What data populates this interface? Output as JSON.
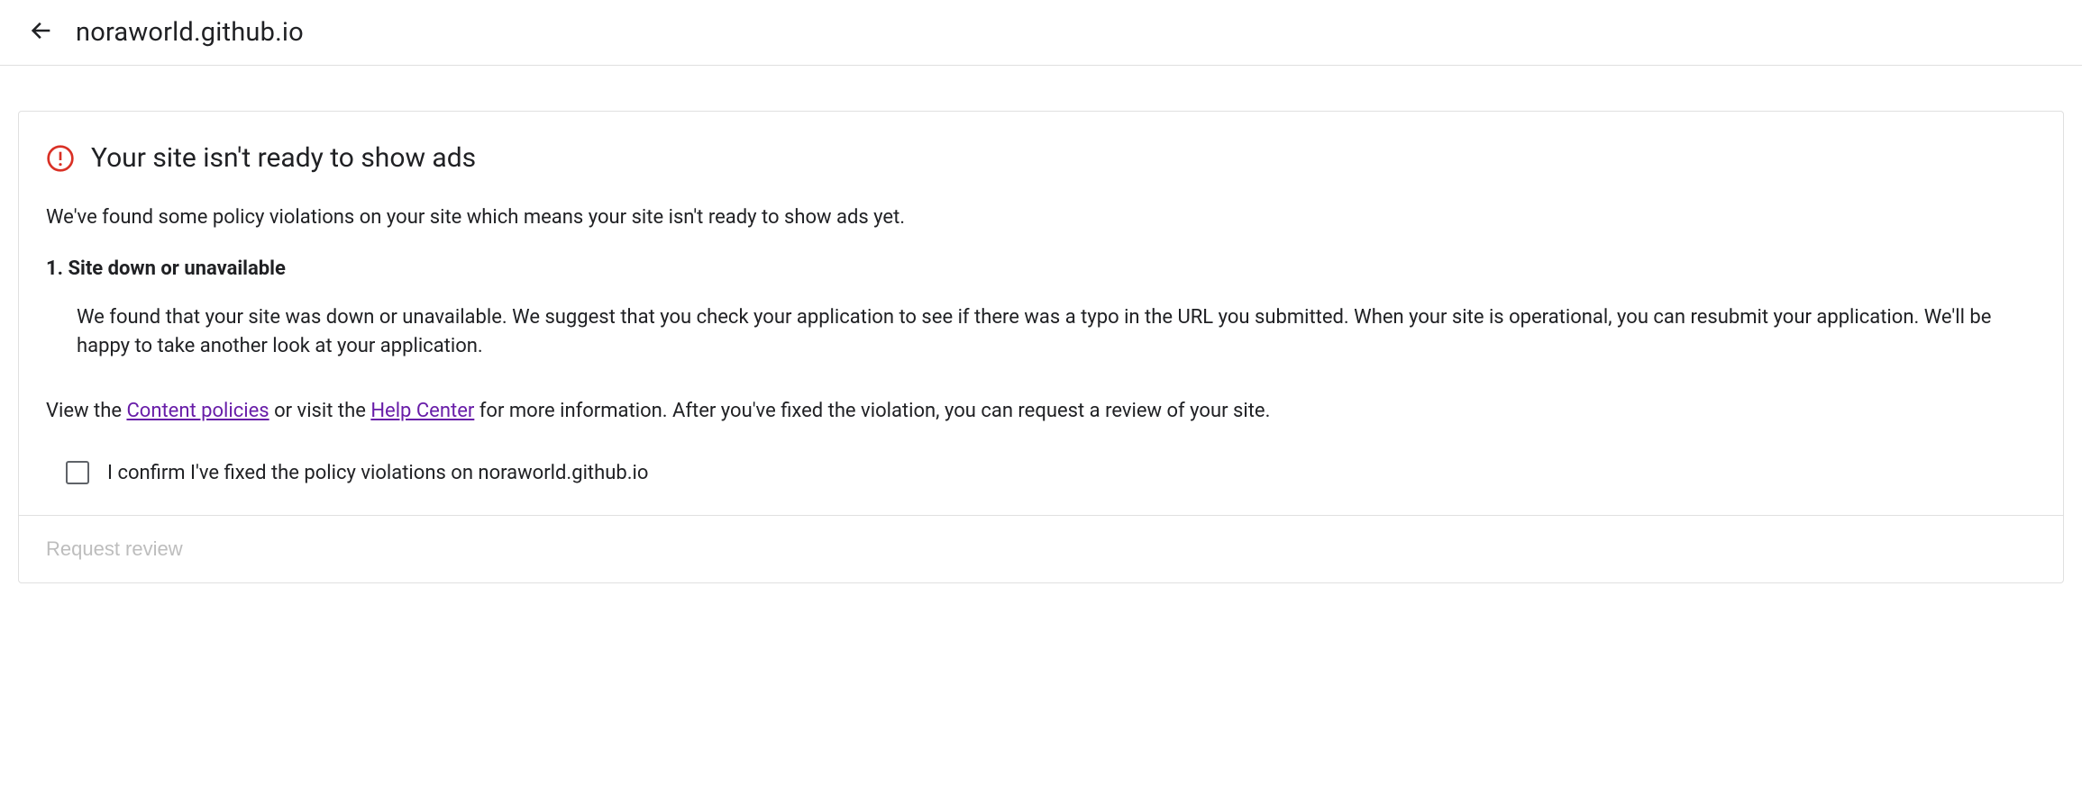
{
  "header": {
    "domain": "noraworld.github.io"
  },
  "card": {
    "title": "Your site isn't ready to show ads",
    "intro": "We've found some policy violations on your site which means your site isn't ready to show ads yet.",
    "violation_heading": "1. Site down or unavailable",
    "violation_body": "We found that your site was down or unavailable. We suggest that you check your application to see if there was a typo in the URL you submitted. When your site is operational, you can resubmit your application. We'll be happy to take another look at your application.",
    "info_pre": "View the ",
    "link1": "Content policies",
    "info_mid": " or visit the ",
    "link2": "Help Center",
    "info_post": " for more information. After you've fixed the violation, you can request a review of your site.",
    "confirm_label": "I confirm I've fixed the policy violations on noraworld.github.io",
    "request_button": "Request review"
  }
}
